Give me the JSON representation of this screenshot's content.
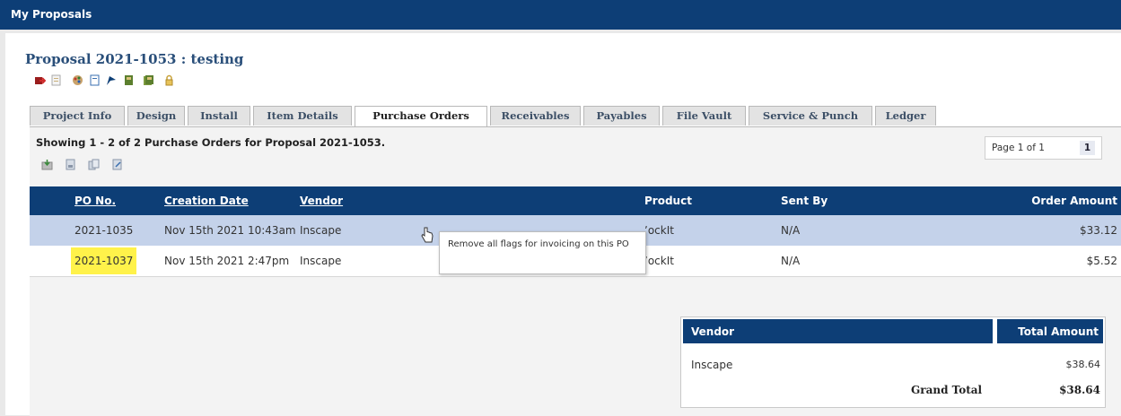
{
  "app": {
    "title": "My Proposals"
  },
  "proposal": {
    "title": "Proposal 2021-1053 : testing"
  },
  "toolbar_icons": [
    "exit-icon",
    "document-icon",
    "palette-icon",
    "page-icon",
    "flag-icon",
    "book-icon",
    "book-stack-icon",
    "lock-icon"
  ],
  "tabs": [
    {
      "label": "Project Info"
    },
    {
      "label": "Design"
    },
    {
      "label": "Install"
    },
    {
      "label": "Item Details"
    },
    {
      "label": "Purchase Orders",
      "active": true
    },
    {
      "label": "Receivables"
    },
    {
      "label": "Payables"
    },
    {
      "label": "File Vault"
    },
    {
      "label": "Service & Punch"
    },
    {
      "label": "Ledger"
    }
  ],
  "purchase_orders": {
    "showing_text": "Showing 1 - 2 of 2 Purchase Orders for Proposal 2021-1053.",
    "action_icons": [
      "export-icon",
      "print-icon",
      "copy-icon",
      "send-icon"
    ],
    "pager": {
      "text": "Page 1 of 1",
      "current": "1"
    },
    "columns": {
      "po_no": "PO No.",
      "creation_date": "Creation Date",
      "vendor": "Vendor",
      "product": "Product",
      "sent_by": "Sent By",
      "order_amount": "Order Amount"
    },
    "rows": [
      {
        "po_no": "2021-1035",
        "creation_date": "Nov 15th 2021 10:43am",
        "vendor": "Inscape",
        "product": "ʼockIt",
        "sent_by": "N/A",
        "order_amount": "$33.12"
      },
      {
        "po_no": "2021-1037",
        "creation_date": "Nov 15th 2021 2:47pm",
        "vendor": "Inscape",
        "product": "ʼockIt",
        "sent_by": "N/A",
        "order_amount": "$5.52"
      }
    ],
    "highlight_color": "#fff24a"
  },
  "tooltip": {
    "text": "Remove all flags for invoicing on this PO"
  },
  "totals": {
    "vendor_header": "Vendor",
    "total_header": "Total Amount",
    "rows": [
      {
        "vendor": "Inscape",
        "amount": "$38.64"
      }
    ],
    "grand_total_label": "Grand Total",
    "grand_total_value": "$38.64"
  },
  "colors": {
    "header_blue": "#0d3e76",
    "selected_row": "#c4d2ea"
  }
}
